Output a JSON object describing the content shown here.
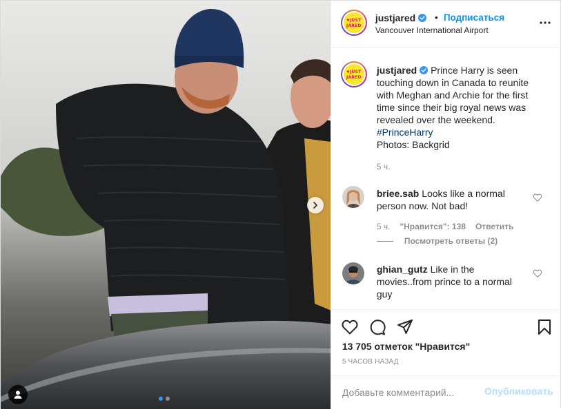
{
  "post": {
    "author": {
      "username": "justjared",
      "verified": true,
      "logo_text_top": "JUST",
      "logo_text_bottom": "JARED",
      "logo_heart": "♥",
      "logo_color": "#fbe62b"
    },
    "header": {
      "separator": "•",
      "follow_label": "Подписаться",
      "location": "Vancouver International Airport",
      "more_icon": "more-horizontal-icon"
    },
    "caption": {
      "username": "justjared",
      "text": "Prince Harry is seen touching down in Canada to reunite with Meghan and Archie for the first time since their big royal news was revealed over the weekend.",
      "hashtag": "#PrinceHarry",
      "credit": "Photos: Backgrid",
      "time": "5 ч."
    },
    "comments": [
      {
        "username": "briee.sab",
        "text": "Looks like a normal person now. Not bad!",
        "time": "5 ч.",
        "likes": "\"Нравится\": 138",
        "reply_label": "Ответить",
        "view_replies": "Посмотреть ответы (2)"
      },
      {
        "username": "ghian_gutz",
        "text": "Like in the movies..from prince to a normal guy"
      }
    ],
    "likes_count": "13 705 отметок \"Нравится\"",
    "posted_ago": "5 ЧАСОВ НАЗАД",
    "add_comment": {
      "placeholder": "Добавьте комментарий...",
      "publish_label": "Опубликовать"
    },
    "carousel": {
      "total": 2,
      "current": 1
    },
    "colors": {
      "accent": "#0095f6",
      "muted": "#8e8e8e",
      "publish_disabled": "#b2dffc",
      "hashtag": "#00376b"
    }
  }
}
